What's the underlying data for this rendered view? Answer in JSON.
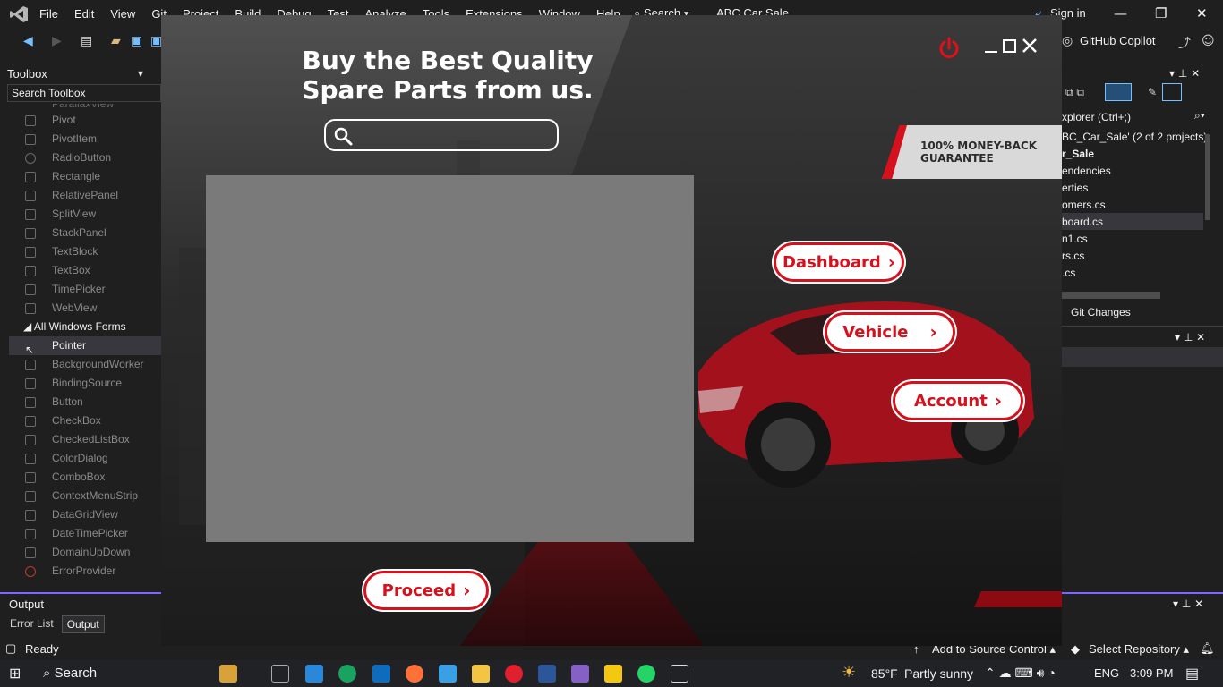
{
  "vs": {
    "menu": [
      "File",
      "Edit",
      "View",
      "Git",
      "Project",
      "Build",
      "Debug",
      "Test",
      "Analyze",
      "Tools",
      "Extensions",
      "Window",
      "Help"
    ],
    "search_label": "Search",
    "solution_name": "ABC Car Sale",
    "sign_in": "Sign in",
    "copilot": "GitHub Copilot"
  },
  "toolbox": {
    "title": "Toolbox",
    "search_placeholder": "Search Toolbox",
    "items_top": [
      "ParallaxView",
      "Pivot",
      "PivotItem",
      "RadioButton",
      "Rectangle",
      "RelativePanel",
      "SplitView",
      "StackPanel",
      "TextBlock",
      "TextBox",
      "TimePicker",
      "WebView"
    ],
    "group_header": "All Windows Forms",
    "items_forms": [
      "Pointer",
      "BackgroundWorker",
      "BindingSource",
      "Button",
      "CheckBox",
      "CheckedListBox",
      "ColorDialog",
      "ComboBox",
      "ContextMenuStrip",
      "DataGridView",
      "DateTimePicker",
      "DomainUpDown",
      "ErrorProvider"
    ]
  },
  "solution_explorer": {
    "search": "xplorer (Ctrl+;)",
    "items": [
      "BC_Car_Sale' (2 of 2 projects)",
      "r_Sale",
      "endencies",
      "erties",
      "omers.cs",
      "board.cs",
      "n1.cs",
      "rs.cs",
      ".cs"
    ],
    "git_changes": "Git Changes"
  },
  "output": {
    "title": "Output",
    "tabs": [
      "Error List",
      "Output"
    ]
  },
  "status": {
    "ready": "Ready",
    "add_source": "Add to Source Control",
    "select_repo": "Select Repository"
  },
  "taskbar": {
    "search": "Search",
    "weather_temp": "85°F",
    "weather_desc": "Partly sunny",
    "lang": "ENG",
    "time": "3:09 PM"
  },
  "app": {
    "headline": "Buy the Best Quality Spare Parts from us.",
    "search_placeholder": "",
    "guarantee": "100% MONEY-BACK GUARANTEE",
    "buttons": {
      "dashboard": "Dashboard",
      "vehicle": "Vehicle",
      "account": "Account",
      "proceed": "Proceed"
    },
    "colors": {
      "accent": "#d4111c",
      "panel": "#7a7a7a"
    }
  }
}
